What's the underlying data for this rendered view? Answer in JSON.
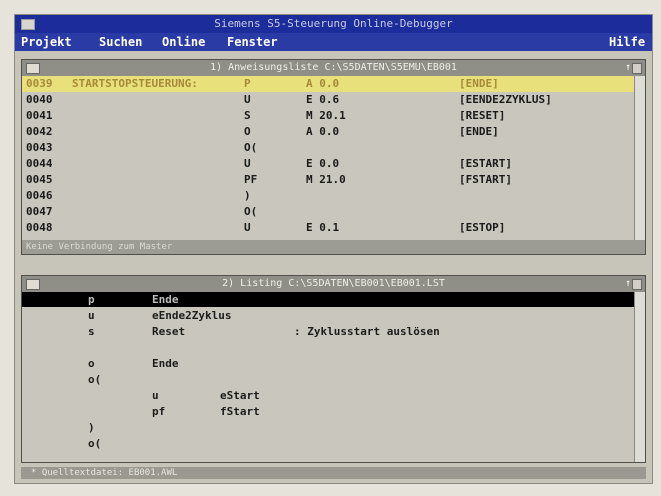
{
  "window": {
    "title": "Siemens S5-Steuerung Online-Debugger"
  },
  "menu": {
    "projekt": "Projekt",
    "suchen": "Suchen",
    "online": "Online",
    "fenster": "Fenster",
    "hilfe": "Hilfe"
  },
  "pane1": {
    "title": "1) Anweisungsliste  C:\\S5DATEN\\S5EMU\\EB001",
    "max_icon": "↑",
    "status": "Keine Verbindung zum Master",
    "rows": [
      {
        "addr": "0039",
        "comment": "STARTSTOPSTEUERUNG:",
        "op": "P",
        "operand": "A 0.0",
        "label": "[ENDE]"
      },
      {
        "addr": "0040",
        "comment": "",
        "op": "U",
        "operand": "E 0.6",
        "label": "[EENDE2ZYKLUS]"
      },
      {
        "addr": "0041",
        "comment": "",
        "op": "S",
        "operand": "M 20.1",
        "label": "[RESET]"
      },
      {
        "addr": "0042",
        "comment": "",
        "op": "O",
        "operand": "A 0.0",
        "label": "[ENDE]"
      },
      {
        "addr": "0043",
        "comment": "",
        "op": "O(",
        "operand": "",
        "label": ""
      },
      {
        "addr": "0044",
        "comment": "",
        "op": "U",
        "operand": "E 0.0",
        "label": "[ESTART]"
      },
      {
        "addr": "0045",
        "comment": "",
        "op": "PF",
        "operand": "M 21.0",
        "label": "[FSTART]"
      },
      {
        "addr": "0046",
        "comment": "",
        "op": ")",
        "operand": "",
        "label": ""
      },
      {
        "addr": "0047",
        "comment": "",
        "op": "O(",
        "operand": "",
        "label": ""
      },
      {
        "addr": "0048",
        "comment": "",
        "op": "U",
        "operand": "E 0.1",
        "label": "[ESTOP]"
      }
    ]
  },
  "pane2": {
    "title": "2) Listing  C:\\S5DATEN\\EB001\\EB001.LST",
    "max_icon": "↑",
    "rows": [
      {
        "c1": "p",
        "c2": "Ende",
        "c3": "",
        "c4": ""
      },
      {
        "c1": "u",
        "c2": "eEnde2Zyklus",
        "c3": "",
        "c4": ""
      },
      {
        "c1": "s",
        "c2": "Reset",
        "c3": "",
        "c4": ": Zyklusstart auslösen"
      },
      {
        "c1": "",
        "c2": "",
        "c3": "",
        "c4": ""
      },
      {
        "c1": "o",
        "c2": "Ende",
        "c3": "",
        "c4": ""
      },
      {
        "c1": "o(",
        "c2": "",
        "c3": "",
        "c4": ""
      },
      {
        "c1": "",
        "c2": "u",
        "c3": "eStart",
        "c4": ""
      },
      {
        "c1": "",
        "c2": "pf",
        "c3": "fStart",
        "c4": ""
      },
      {
        "c1": ")",
        "c2": "",
        "c3": "",
        "c4": ""
      },
      {
        "c1": "o(",
        "c2": "",
        "c3": "",
        "c4": ""
      }
    ]
  },
  "statusbar": {
    "text": "*  Quelltextdatei: EB001.AWL"
  }
}
